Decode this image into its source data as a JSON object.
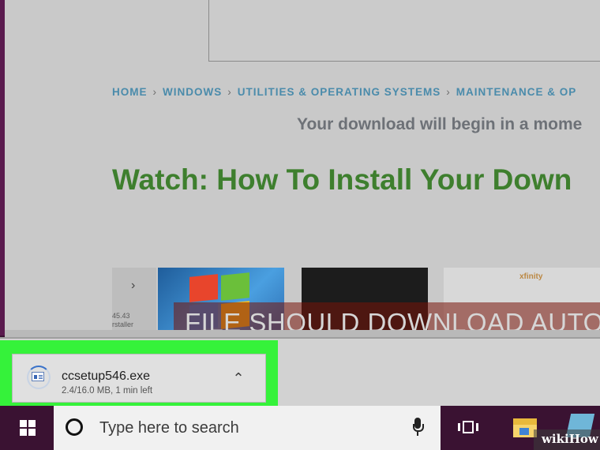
{
  "browser_page": {
    "breadcrumb": [
      {
        "label": "HOME"
      },
      {
        "label": "WINDOWS"
      },
      {
        "label": "UTILITIES & OPERATING SYSTEMS"
      },
      {
        "label": "MAINTENANCE & OP"
      }
    ],
    "breadcrumb_separator": "›",
    "download_message": "Your download will begin in a mome",
    "watch_title": "Watch: How To Install Your Down",
    "thumb_nav": "›",
    "thumb_meta_time": "45.43",
    "thumb_meta_sub": "rstaller",
    "thumb_brand": "xfinity",
    "overlay_caption": "FILE SHOULD DOWNLOAD AUTO"
  },
  "download_shelf": {
    "file_name": "ccsetup546.exe",
    "status": "2.4/16.0 MB, 1 min left",
    "chevron": "⌃",
    "highlight_color": "#35f23a"
  },
  "taskbar": {
    "search_placeholder": "Type here to search",
    "icons": [
      "windows-start-icon",
      "cortana-icon",
      "microphone-icon",
      "task-view-icon",
      "file-explorer-icon",
      "app-icon"
    ]
  },
  "watermark": {
    "text": "wikiHow"
  }
}
